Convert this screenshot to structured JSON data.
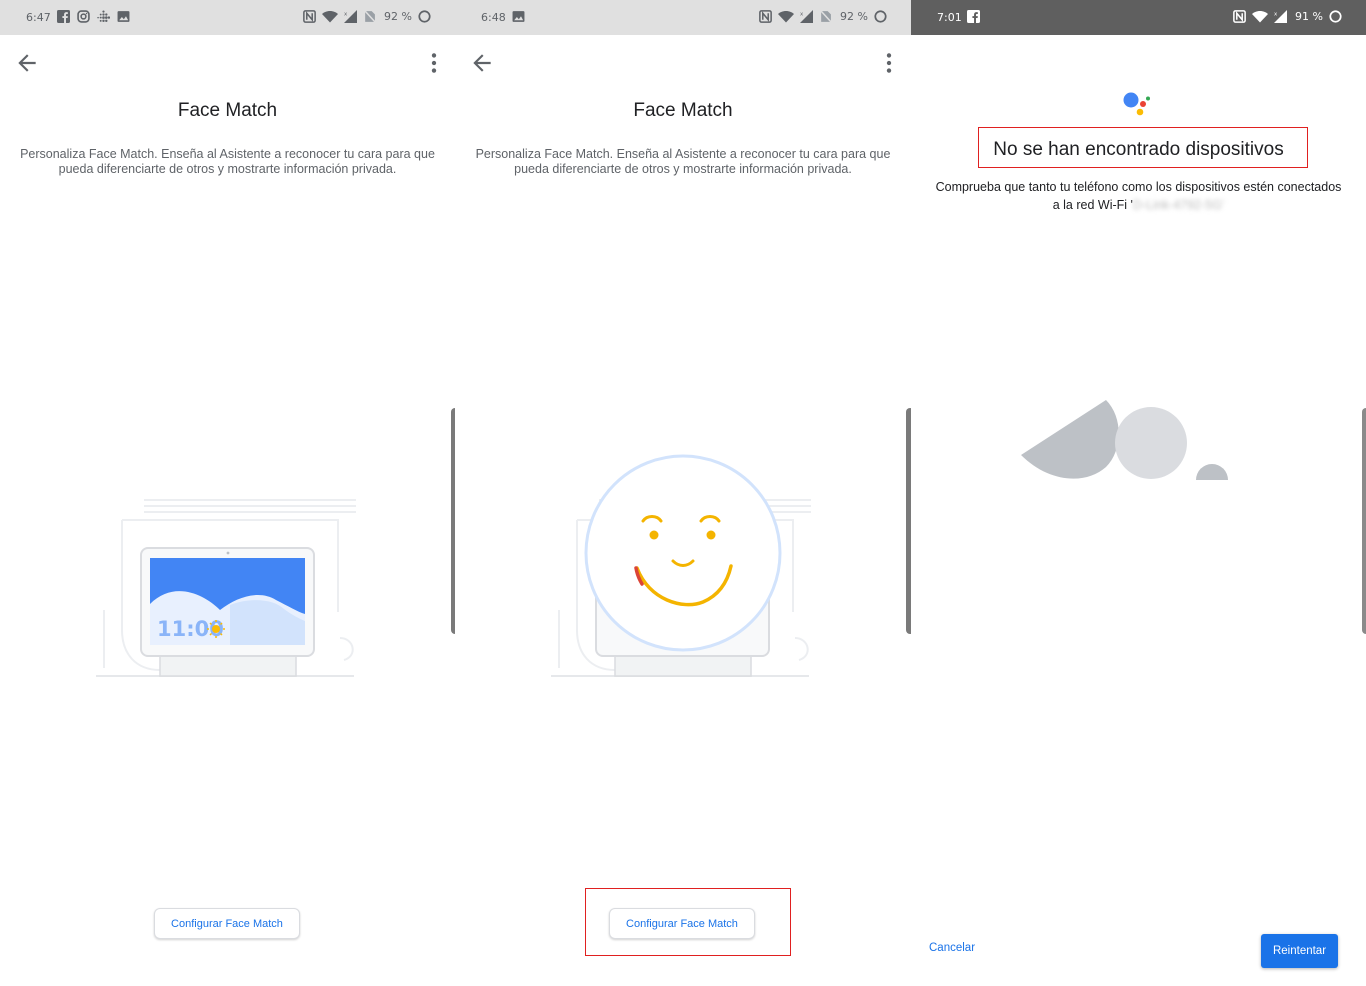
{
  "panel1": {
    "status": {
      "time": "6:47",
      "battery": "92 %"
    },
    "title": "Face Match",
    "description": "Personaliza Face Match. Enseña al Asistente a reconocer tu cara para que pueda diferenciarte de otros y mostrarte información privada.",
    "display_clock": "11:00",
    "button_label": "Configurar Face Match"
  },
  "panel2": {
    "status": {
      "time": "6:48",
      "battery": "92 %"
    },
    "title": "Face Match",
    "description": "Personaliza Face Match. Enseña al Asistente a reconocer tu cara para que pueda diferenciarte de otros y mostrarte información privada.",
    "button_label": "Configurar Face Match"
  },
  "panel3": {
    "status": {
      "time": "7:01",
      "battery": "91 %"
    },
    "heading": "No se han encontrado dispositivos",
    "description_line1": "Comprueba que tanto tu teléfono como los dispositivos estén conectados",
    "description_line2_prefix": "a la red Wi-Fi '",
    "wifi_name_obscured": "D-Link-4792-5G'",
    "cancel_label": "Cancelar",
    "retry_label": "Reintentar"
  },
  "colors": {
    "accent": "#1a73e8",
    "highlight_box": "#e02020",
    "status_bar_light": "#e0e0e0",
    "status_bar_dark": "#5f5f5f",
    "face_yellow": "#f4b400",
    "face_red": "#db4437"
  }
}
